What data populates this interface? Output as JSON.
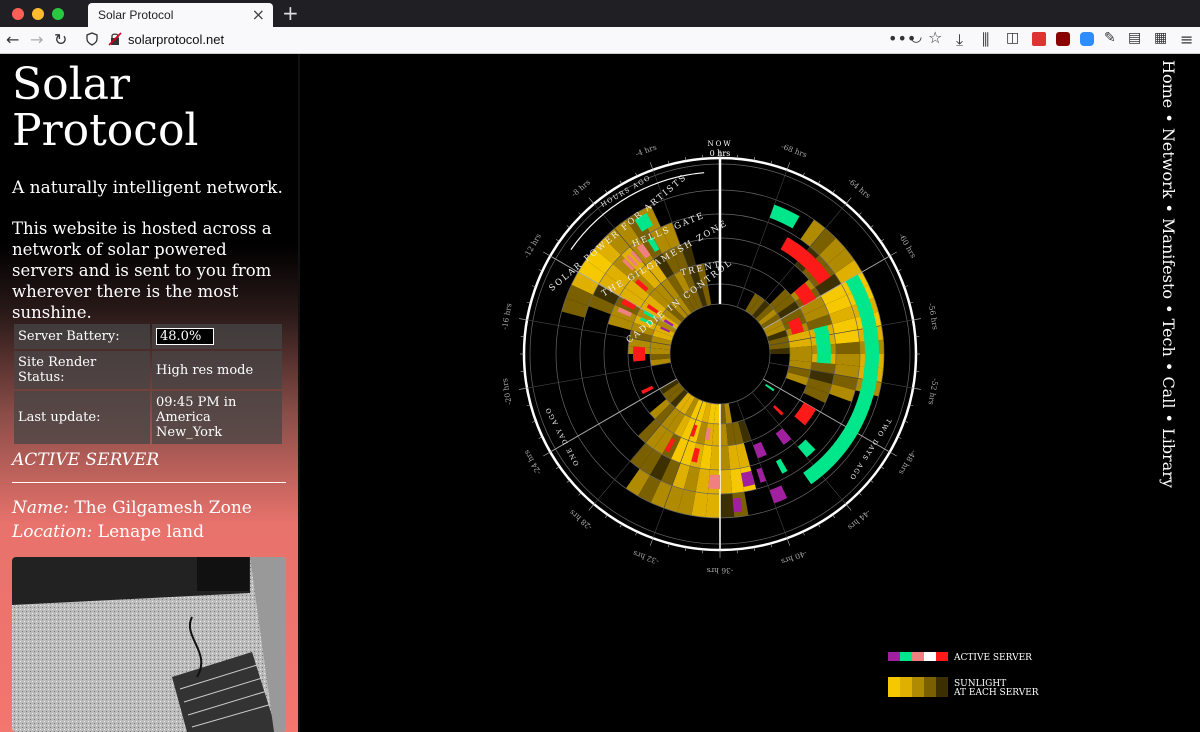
{
  "browser": {
    "tab_title": "Solar Protocol",
    "url": "solarprotocol.net"
  },
  "site": {
    "title_line1": "Solar",
    "title_line2": "Protocol",
    "tagline": "A naturally intelligent network.",
    "description": "This website is hosted across a network of solar powered servers and is sent to you from wherever there is the most sunshine.",
    "stats": {
      "battery_label": "Server Battery:",
      "battery_value": "48.0%",
      "render_label": "Site Render Status:",
      "render_value": "High res mode",
      "update_label": "Last update:",
      "update_value": "09:45 PM in America New_York"
    },
    "active_server": {
      "heading": "ACTIVE SERVER",
      "name_label": "Name:",
      "name_value": "The Gilgamesh Zone",
      "location_label": "Location:",
      "location_value": "Lenape land"
    }
  },
  "nav": {
    "items": [
      "Home",
      "Network",
      "Manifesto",
      "Tech",
      "Call",
      "Library"
    ],
    "separator": " • "
  },
  "diagram": {
    "now_label": "NOW",
    "now_hours": "0 hrs",
    "hours_ago_label": "HOURS AGO",
    "one_day_ago_label": "ONE DAY AGO",
    "two_days_ago_label": "TWO DAYS AGO",
    "server_rings": [
      "SOLAR POWER FOR ARTISTS",
      "HELLS GATE",
      "THE GILGAMESH ZONE",
      "TRENT",
      "CADDIE IN CONTROL"
    ],
    "hour_ticks": [
      "-4 hrs",
      "-8 hrs",
      "-12 hrs",
      "-16 hrs",
      "-20 hrs",
      "-24 hrs",
      "-28 hrs",
      "-32 hrs",
      "-36 hrs",
      "-40 hrs",
      "-44 hrs",
      "-48 hrs",
      "-52 hrs",
      "-56 hrs",
      "-60 hrs",
      "-64 hrs",
      "-68 hrs"
    ],
    "legend": {
      "active_server": "ACTIVE SERVER",
      "sunlight_line1": "SUNLIGHT",
      "sunlight_line2": "AT EACH SERVER"
    },
    "server_colors": [
      "#a020a0",
      "#00e68a",
      "#f08080",
      "#ffffff",
      "#ff1a1a"
    ],
    "sunlight_colors": [
      "#f5c800",
      "#e0b000",
      "#b08a00",
      "#7a6000",
      "#3d3000"
    ]
  }
}
